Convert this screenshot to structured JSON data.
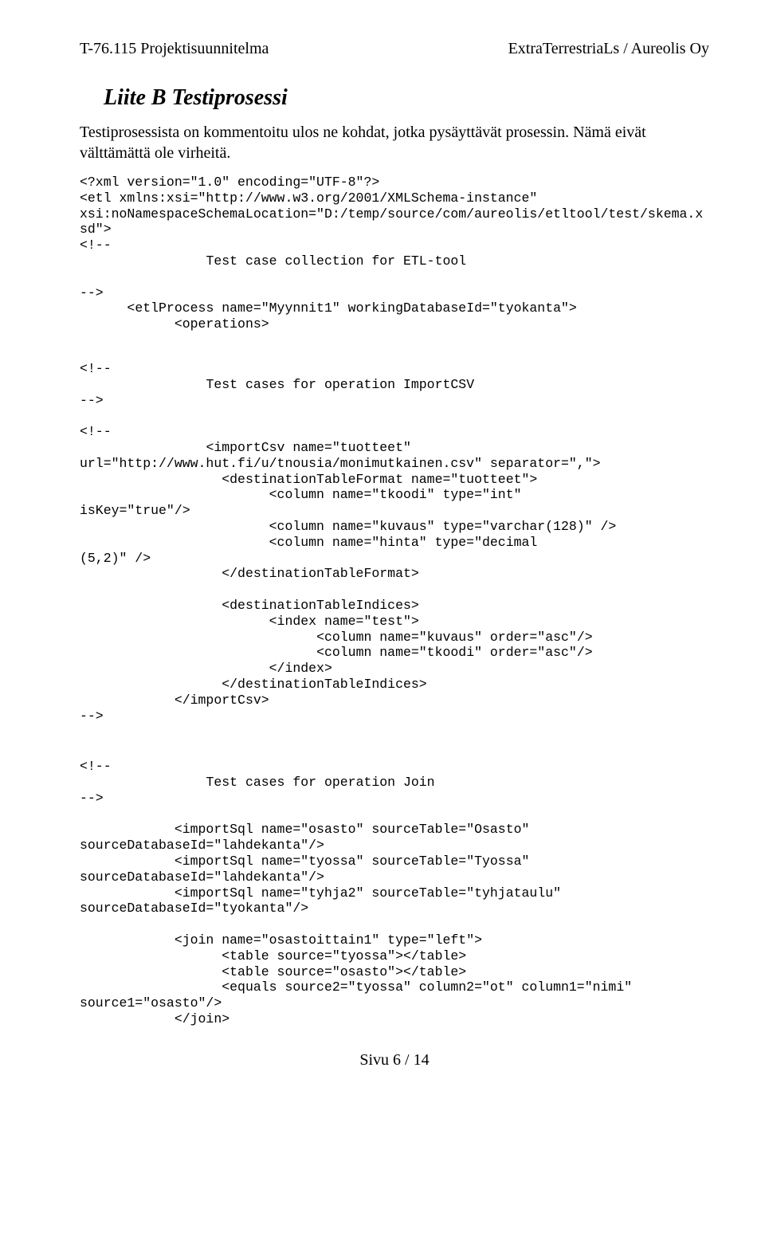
{
  "header": {
    "left": "T-76.115 Projektisuunnitelma",
    "right": "ExtraTerrestriaLs / Aureolis Oy"
  },
  "title": "Liite B Testiprosessi",
  "intro": "Testiprosessista on kommentoitu ulos ne kohdat, jotka pysäyttävät prosessin. Nämä eivät välttämättä ole virheitä.",
  "code1": "<?xml version=\"1.0\" encoding=\"UTF-8\"?>\n<etl xmlns:xsi=\"http://www.w3.org/2001/XMLSchema-instance\"\nxsi:noNamespaceSchemaLocation=\"D:/temp/source/com/aureolis/etltool/test/skema.x\nsd\">\n<!--\n                Test case collection for ETL-tool\n\n-->\n      <etlProcess name=\"Myynnit1\" workingDatabaseId=\"tyokanta\">\n            <operations>",
  "code2": "<!--\n                Test cases for operation ImportCSV\n-->\n\n<!--\n                <importCsv name=\"tuotteet\"\nurl=\"http://www.hut.fi/u/tnousia/monimutkainen.csv\" separator=\",\">\n                  <destinationTableFormat name=\"tuotteet\">\n                        <column name=\"tkoodi\" type=\"int\"\nisKey=\"true\"/>\n                        <column name=\"kuvaus\" type=\"varchar(128)\" />\n                        <column name=\"hinta\" type=\"decimal\n(5,2)\" />\n                  </destinationTableFormat>\n\n                  <destinationTableIndices>\n                        <index name=\"test\">\n                              <column name=\"kuvaus\" order=\"asc\"/>\n                              <column name=\"tkoodi\" order=\"asc\"/>\n                        </index>\n                  </destinationTableIndices>\n            </importCsv>\n-->",
  "code3": "<!--\n                Test cases for operation Join\n-->\n\n            <importSql name=\"osasto\" sourceTable=\"Osasto\"\nsourceDatabaseId=\"lahdekanta\"/>\n            <importSql name=\"tyossa\" sourceTable=\"Tyossa\"\nsourceDatabaseId=\"lahdekanta\"/>\n            <importSql name=\"tyhja2\" sourceTable=\"tyhjataulu\"\nsourceDatabaseId=\"tyokanta\"/>\n\n            <join name=\"osastoittain1\" type=\"left\">\n                  <table source=\"tyossa\"></table>\n                  <table source=\"osasto\"></table>\n                  <equals source2=\"tyossa\" column2=\"ot\" column1=\"nimi\"\nsource1=\"osasto\"/>\n            </join>",
  "footer": "Sivu 6 / 14"
}
